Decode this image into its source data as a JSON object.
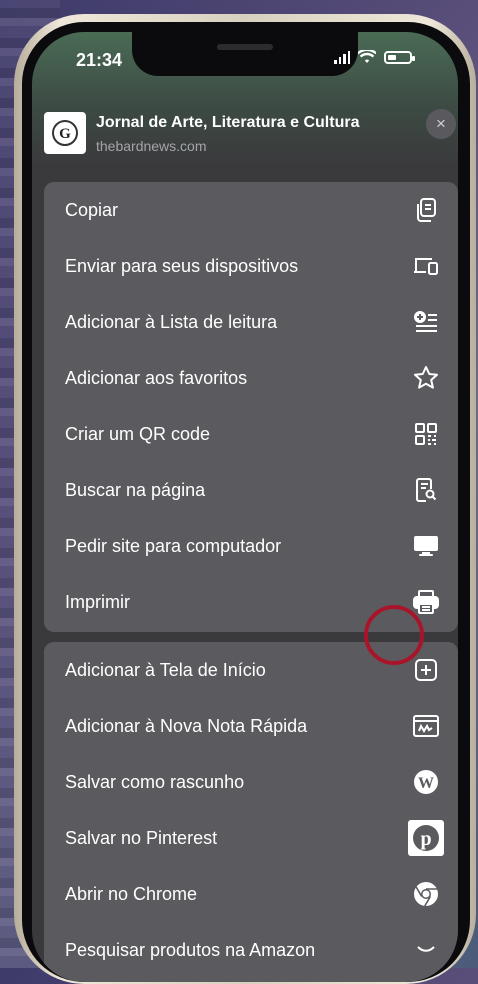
{
  "status_bar": {
    "time": "21:34"
  },
  "site": {
    "title": "Jornal de Arte, Literatura e Cultura",
    "url": "thebardnews.com",
    "favicon_letter": "G"
  },
  "close_icon": "×",
  "highlight_color": "#a8152a",
  "menu_group_1": [
    {
      "label": "Copiar",
      "icon": "copy-icon"
    },
    {
      "label": "Enviar para seus dispositivos",
      "icon": "devices-icon"
    },
    {
      "label": "Adicionar à Lista de leitura",
      "icon": "reading-list-icon"
    },
    {
      "label": "Adicionar aos favoritos",
      "icon": "star-icon"
    },
    {
      "label": "Criar um QR code",
      "icon": "qr-code-icon"
    },
    {
      "label": "Buscar na página",
      "icon": "find-in-page-icon"
    },
    {
      "label": "Pedir site para computador",
      "icon": "desktop-icon"
    },
    {
      "label": "Imprimir",
      "icon": "printer-icon"
    }
  ],
  "menu_group_2": [
    {
      "label": "Adicionar à Tela de Início",
      "icon": "add-square-icon"
    },
    {
      "label": "Adicionar à Nova Nota Rápida",
      "icon": "quick-note-icon"
    },
    {
      "label": "Salvar como rascunho",
      "icon": "wordpress-icon"
    },
    {
      "label": "Salvar no Pinterest",
      "icon": "pinterest-icon"
    },
    {
      "label": "Abrir no Chrome",
      "icon": "chrome-icon"
    },
    {
      "label": "Pesquisar produtos na Amazon",
      "icon": "chevron-icon"
    }
  ]
}
